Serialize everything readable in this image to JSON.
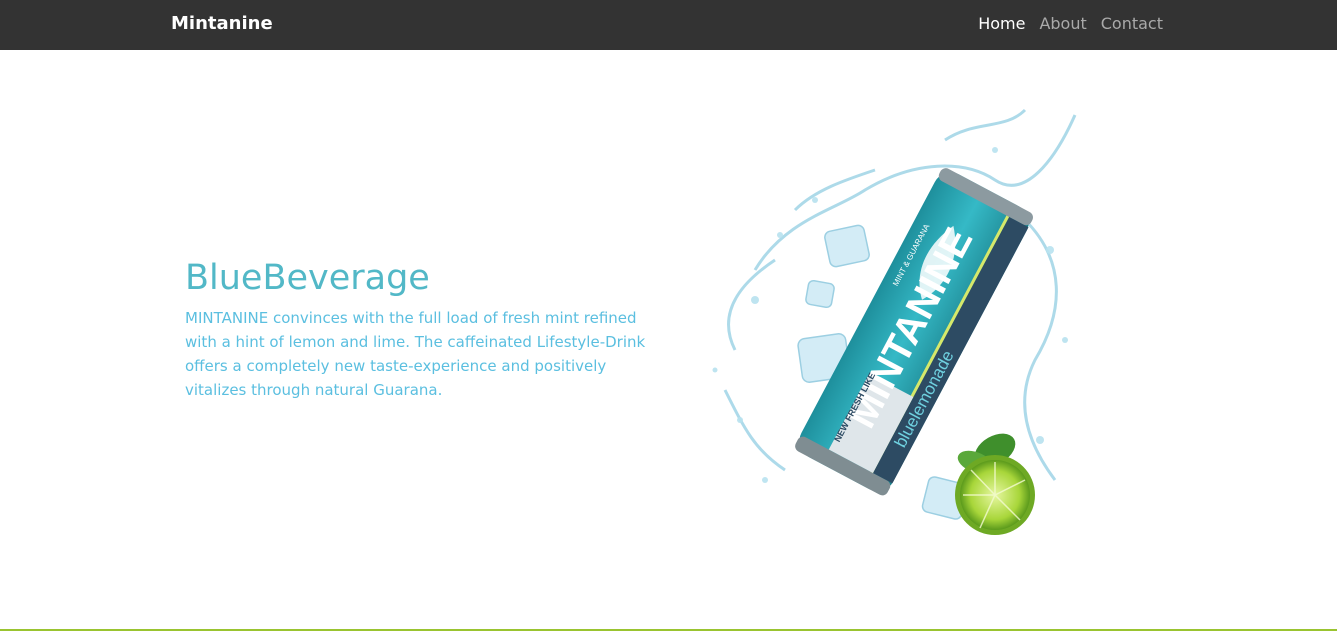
{
  "navbar": {
    "brand": "Mintanine",
    "links": [
      {
        "label": "Home",
        "active": true
      },
      {
        "label": "About",
        "active": false
      },
      {
        "label": "Contact",
        "active": false
      }
    ]
  },
  "hero": {
    "title": "BlueBeverage",
    "text": "MINTANINE convinces with the full load of fresh mint refined with a hint of lemon and lime. The caffeinated Lifestyle-Drink offers a completely new taste-experience and positively vitalizes through natural Guarana."
  },
  "product_image": {
    "brand_text": "MINTANINE",
    "flavor_text": "bluelemonade",
    "tagline": "MINT & GUARANA",
    "badge_text": "NEW FRESH LIKE"
  },
  "colors": {
    "navbar_bg": "#333333",
    "accent": "#52b8c7",
    "text_blue": "#5bbfe0",
    "can_teal": "#2aa7b4",
    "bottom_border": "#9ac430"
  }
}
